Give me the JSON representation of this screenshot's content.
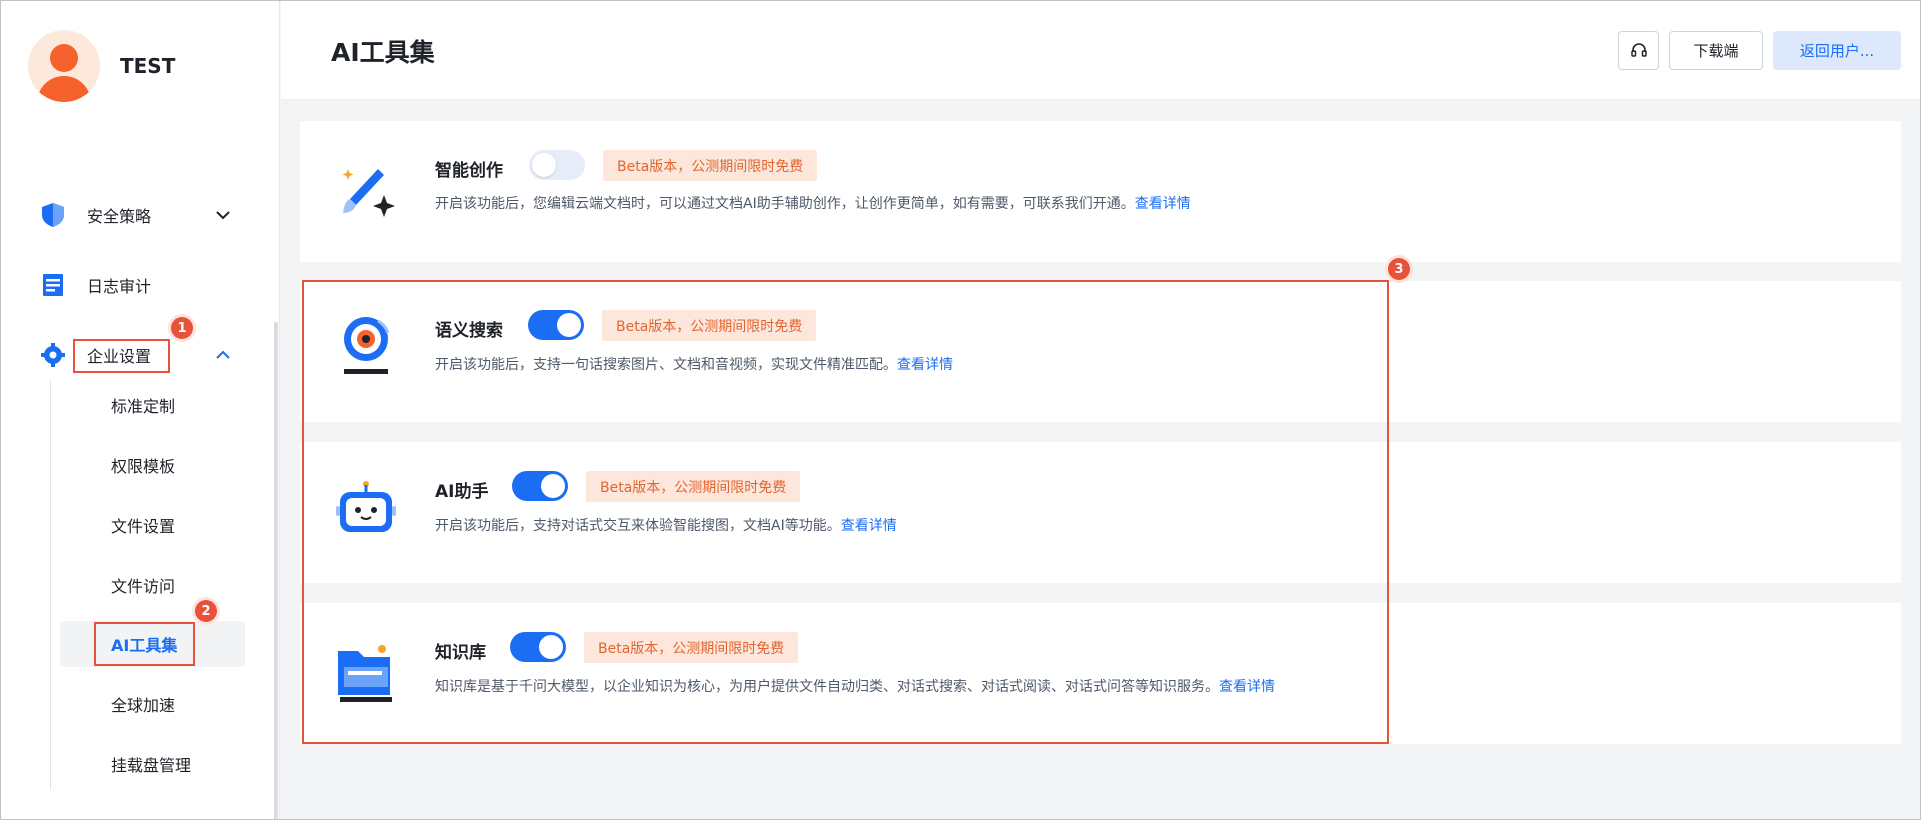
{
  "user": {
    "name": "TEST"
  },
  "nav": {
    "items": [
      {
        "label": "安全策略",
        "icon": "shield-icon",
        "expanded": false
      },
      {
        "label": "日志审计",
        "icon": "log-icon"
      },
      {
        "label": "企业设置",
        "icon": "gear-icon",
        "expanded": true
      }
    ],
    "sub_items": [
      {
        "label": "标准定制"
      },
      {
        "label": "权限模板"
      },
      {
        "label": "文件设置"
      },
      {
        "label": "文件访问"
      },
      {
        "label": "AI工具集",
        "active": true
      },
      {
        "label": "全球加速"
      },
      {
        "label": "挂载盘管理"
      }
    ]
  },
  "steps": [
    "1",
    "2",
    "3"
  ],
  "header": {
    "title": "AI工具集",
    "support_icon": "headset-icon",
    "download_label": "下载端",
    "back_label": "返回用户..."
  },
  "tools": [
    {
      "title": "智能创作",
      "icon": "magic-brush-icon",
      "enabled": false,
      "badge": "Beta版本，公测期间限时免费",
      "desc": "开启该功能后，您编辑云端文档时，可以通过文档AI助手辅助创作，让创作更简单，如有需要，可联系我们开通。",
      "link": "查看详情"
    },
    {
      "title": "语义搜索",
      "icon": "camera-search-icon",
      "enabled": true,
      "badge": "Beta版本，公测期间限时免费",
      "desc": "开启该功能后，支持一句话搜索图片、文档和音视频，实现文件精准匹配。",
      "link": "查看详情"
    },
    {
      "title": "AI助手",
      "icon": "robot-icon",
      "enabled": true,
      "badge": "Beta版本，公测期间限时免费",
      "desc": "开启该功能后，支持对话式交互来体验智能搜图，文档AI等功能。",
      "link": "查看详情"
    },
    {
      "title": "知识库",
      "icon": "folder-knowledge-icon",
      "enabled": true,
      "badge": "Beta版本，公测期间限时免费",
      "desc": "知识库是基于千问大模型，以企业知识为核心，为用户提供文件自动归类、对话式搜索、对话式阅读、对话式问答等知识服务。",
      "link": "查看详情"
    }
  ],
  "colors": {
    "accent": "#1b6ef3",
    "annotation": "#e8523a",
    "badge_bg": "#fde7dc",
    "badge_text": "#e3652e"
  }
}
